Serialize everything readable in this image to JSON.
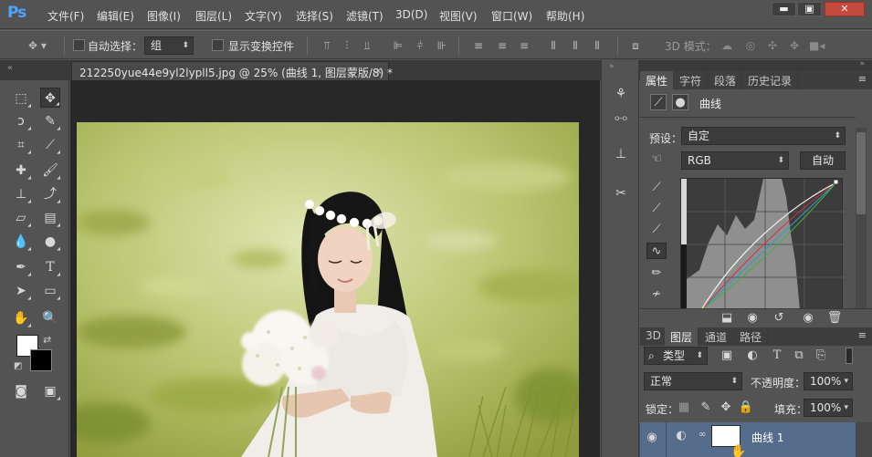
{
  "app": {
    "logo": "Ps"
  },
  "menu": [
    "文件(F)",
    "编辑(E)",
    "图像(I)",
    "图层(L)",
    "文字(Y)",
    "选择(S)",
    "滤镜(T)",
    "3D(D)",
    "视图(V)",
    "窗口(W)",
    "帮助(H)"
  ],
  "window_controls": {
    "minimize": "▬",
    "maximize": "▣",
    "close": "✕"
  },
  "options": {
    "auto_select_label": "自动选择：",
    "auto_select_value": "组",
    "show_transform_label": "显示变换控件",
    "mode_3d_label": "3D 模式："
  },
  "document": {
    "tab_title": "212250yue44e9yl2lypll5.jpg @ 25% (曲线 1, 图层蒙版/8) *",
    "close": "×"
  },
  "properties_panel": {
    "tabs": [
      "属性",
      "字符",
      "段落",
      "历史记录"
    ],
    "adjustment_name": "曲线",
    "preset_label": "预设：",
    "preset_value": "自定",
    "channel_value": "RGB",
    "auto_button": "自动"
  },
  "layers_panel": {
    "tabs": [
      "3D",
      "图层",
      "通道",
      "路径"
    ],
    "filter_label": "类型",
    "blend_mode": "正常",
    "opacity_label": "不透明度：",
    "opacity_value": "100%",
    "lock_label": "锁定：",
    "fill_label": "填充：",
    "fill_value": "100%",
    "layer_name": "曲线 1"
  },
  "colors": {
    "foreground": "#ffffff",
    "background": "#000000",
    "selected_layer": "#556c8c",
    "ps_blue": "#4ea3ff"
  }
}
